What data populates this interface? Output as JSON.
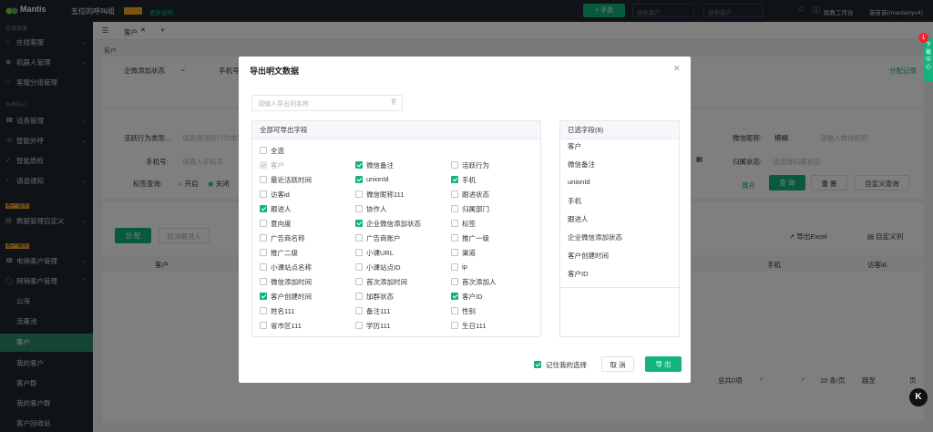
{
  "topbar": {
    "logo": "Mantis",
    "org_name": "五位的呼叫组",
    "update_link": "更新说明",
    "add_button": "+ 手选",
    "search1_placeholder": "搜索客户",
    "search2_placeholder": "搜索客户",
    "workbench_link": "助教工作台",
    "user": "苗苗苗(miaotianyu4)"
  },
  "sidebar": {
    "sections": [
      {
        "label": "在线客服",
        "items": [
          {
            "label": "在线客服",
            "icon": "chat-icon",
            "chev": true
          },
          {
            "label": "机器人管理",
            "icon": "robot-icon",
            "chev": true
          },
          {
            "label": "客服分组管理",
            "icon": "group-icon",
            "chev": false
          }
        ]
      },
      {
        "label": "外呼中心",
        "items": [
          {
            "label": "话务管理",
            "icon": "phone-icon",
            "chev": true
          },
          {
            "label": "智能外呼",
            "icon": "call-icon",
            "chev": true
          },
          {
            "label": "智能质检",
            "icon": "check-icon",
            "chev": false
          },
          {
            "label": "语音通知",
            "icon": "bell-icon",
            "chev": true
          }
        ]
      },
      {
        "label": "客户管理",
        "items": [
          {
            "label": "数据管理自定义",
            "icon": "data-icon",
            "chev": true
          }
        ]
      },
      {
        "label": "客户服务",
        "items": [
          {
            "label": "电销客户管理",
            "icon": "phone-icon",
            "chev": true
          },
          {
            "label": "网销客户管理",
            "icon": "web-icon",
            "chev": true
          }
        ]
      }
    ],
    "sub_items": [
      "公海",
      "流量池",
      "客户",
      "我的客户",
      "客户群",
      "我的客户群",
      "客户回收站"
    ]
  },
  "background": {
    "tab": "客户",
    "breadcrumb": "客户",
    "filter_wechat_status": "企微添加状态",
    "filter_phone": "手机号",
    "assign_log": "分配记录",
    "activity_type_label": "活跃行为类型...",
    "activity_type_placeholder": "请选择活跃行为类型",
    "phone_label": "手机号:",
    "phone_placeholder": "请输入手机号",
    "tag_query_label": "标签查询:",
    "tag_on": "开启",
    "tag_off": "关闭",
    "wechat_nick_label": "微信昵称:",
    "fuzzy": "模糊",
    "wechat_nick_placeholder": "请输入微信昵称",
    "dept_label": "归属状态:",
    "dept_placeholder": "请选择归属状态",
    "expand": "展开",
    "query_btn": "查 询",
    "reset_btn": "重 置",
    "custom_query_btn": "自定义查询",
    "assign_btn": "分 配",
    "cancel_assign_btn": "取消跟进人",
    "export_excel": "导出Excel",
    "custom_columns": "自定义列",
    "col_customer": "客户",
    "col_phone": "手机",
    "col_visitor": "访客id",
    "total": "总共0项",
    "page_size": "10 条/页",
    "goto": "跳至",
    "page_unit": "页"
  },
  "modal": {
    "title": "导出明文数据",
    "search_placeholder": "请输入导出列名称",
    "left_header": "全部可导出字段",
    "select_all": "全选",
    "fields": [
      {
        "label": "客户",
        "checked": true,
        "disabled": true
      },
      {
        "label": "微信备注",
        "checked": true
      },
      {
        "label": "活跃行为",
        "checked": false
      },
      {
        "label": "最近活跃时间",
        "checked": false
      },
      {
        "label": "unionId",
        "checked": true
      },
      {
        "label": "手机",
        "checked": true
      },
      {
        "label": "访客id",
        "checked": false
      },
      {
        "label": "微信昵称111",
        "checked": false
      },
      {
        "label": "跟进状态",
        "checked": false
      },
      {
        "label": "跟进人",
        "checked": true
      },
      {
        "label": "协作人",
        "checked": false
      },
      {
        "label": "归属部门",
        "checked": false
      },
      {
        "label": "意向度",
        "checked": false
      },
      {
        "label": "企业微信添加状态",
        "checked": true
      },
      {
        "label": "标签",
        "checked": false
      },
      {
        "label": "广告商名称",
        "checked": false
      },
      {
        "label": "广告商账户",
        "checked": false
      },
      {
        "label": "推广一级",
        "checked": false
      },
      {
        "label": "推广二级",
        "checked": false
      },
      {
        "label": "小课URL",
        "checked": false
      },
      {
        "label": "渠道",
        "checked": false
      },
      {
        "label": "小课站点名称",
        "checked": false
      },
      {
        "label": "小课站点ID",
        "checked": false
      },
      {
        "label": "ip",
        "checked": false
      },
      {
        "label": "微信添加时间",
        "checked": false
      },
      {
        "label": "首次添加时间",
        "checked": false
      },
      {
        "label": "首次添加人",
        "checked": false
      },
      {
        "label": "客户创建时间",
        "checked": true
      },
      {
        "label": "加群状态",
        "checked": false
      },
      {
        "label": "客户ID",
        "checked": true
      },
      {
        "label": "姓名111",
        "checked": false
      },
      {
        "label": "备注111",
        "checked": false
      },
      {
        "label": "性别",
        "checked": false
      },
      {
        "label": "省市区111",
        "checked": false
      },
      {
        "label": "学历111",
        "checked": false
      },
      {
        "label": "生日111",
        "checked": false
      }
    ],
    "right_header": "已选字段(8)",
    "selected": [
      "客户",
      "微信备注",
      "unionId",
      "手机",
      "跟进人",
      "企业微信添加状态",
      "客户创建时间",
      "客户ID"
    ],
    "remember_label": "记住我的选择",
    "remember_checked": true,
    "cancel_label": "取 消",
    "export_label": "导 出"
  },
  "floating": {
    "badge_count": "1",
    "side_tab": "下载中心",
    "k_icon": "K"
  },
  "colors": {
    "primary": "#13b47b",
    "sidebar_bg": "#1f2731",
    "highlight": "#f5a623"
  }
}
